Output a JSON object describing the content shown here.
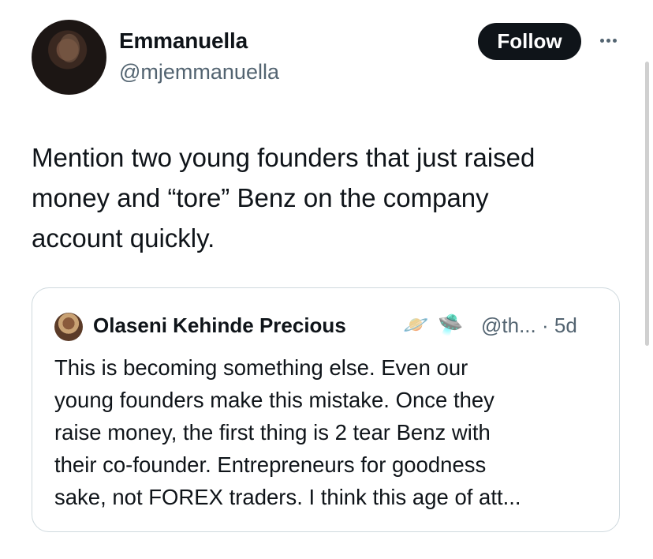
{
  "author": {
    "name": "Emmanuella",
    "handle": "@mjemmanuella",
    "follow_label": "Follow"
  },
  "tweet": {
    "text": "Mention two young founders that just raised\nmoney and “tore” Benz on the company\naccount quickly."
  },
  "quoted_tweet": {
    "author_name": "Olaseni Kehinde Precious",
    "emoji_1": "🪐",
    "emoji_2": "🛸",
    "handle_time": "@th... · 5d",
    "text": "This is becoming something else. Even our\nyoung founders make this mistake. Once they\nraise money, the first thing is 2 tear Benz with\ntheir co-founder. Entrepreneurs for goodness\nsake, not FOREX traders. I think this age of att..."
  },
  "icons": {
    "more": "more-horizontal-icon"
  }
}
